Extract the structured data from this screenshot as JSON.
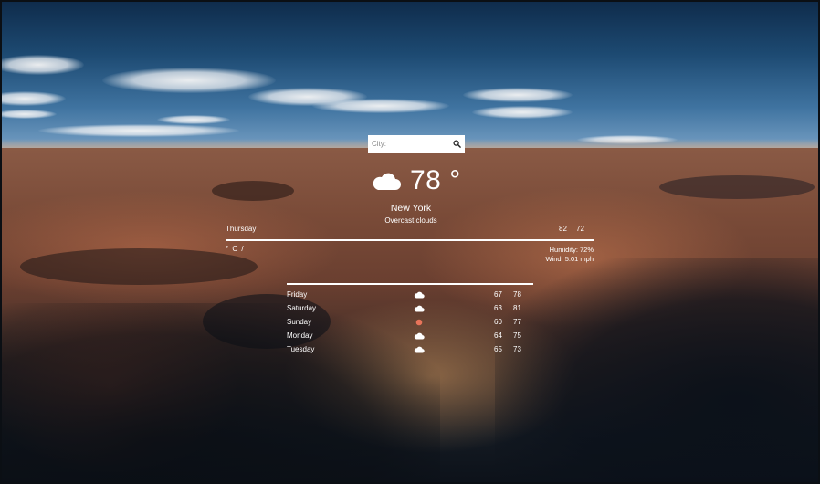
{
  "search": {
    "placeholder": "City:"
  },
  "current": {
    "temperature": "78 °",
    "icon": "cloud-icon",
    "city": "New York",
    "condition": "Overcast clouds"
  },
  "today": {
    "day": "Thursday",
    "high": "82",
    "low": "72"
  },
  "unit_toggle": "° C /",
  "details": {
    "humidity": "Humidity: 72%",
    "wind": "Wind: 5.01 mph"
  },
  "forecast": [
    {
      "day": "Friday",
      "icon": "cloud-icon",
      "high": "67",
      "low": "78"
    },
    {
      "day": "Saturday",
      "icon": "cloud-icon",
      "high": "63",
      "low": "81"
    },
    {
      "day": "Sunday",
      "icon": "sun-icon",
      "high": "60",
      "low": "77"
    },
    {
      "day": "Monday",
      "icon": "cloud-icon",
      "high": "64",
      "low": "75"
    },
    {
      "day": "Tuesday",
      "icon": "cloud-icon",
      "high": "65",
      "low": "73"
    }
  ],
  "colors": {
    "text": "#ffffff",
    "sun": "#e8745a",
    "search_bg": "#ffffff"
  }
}
